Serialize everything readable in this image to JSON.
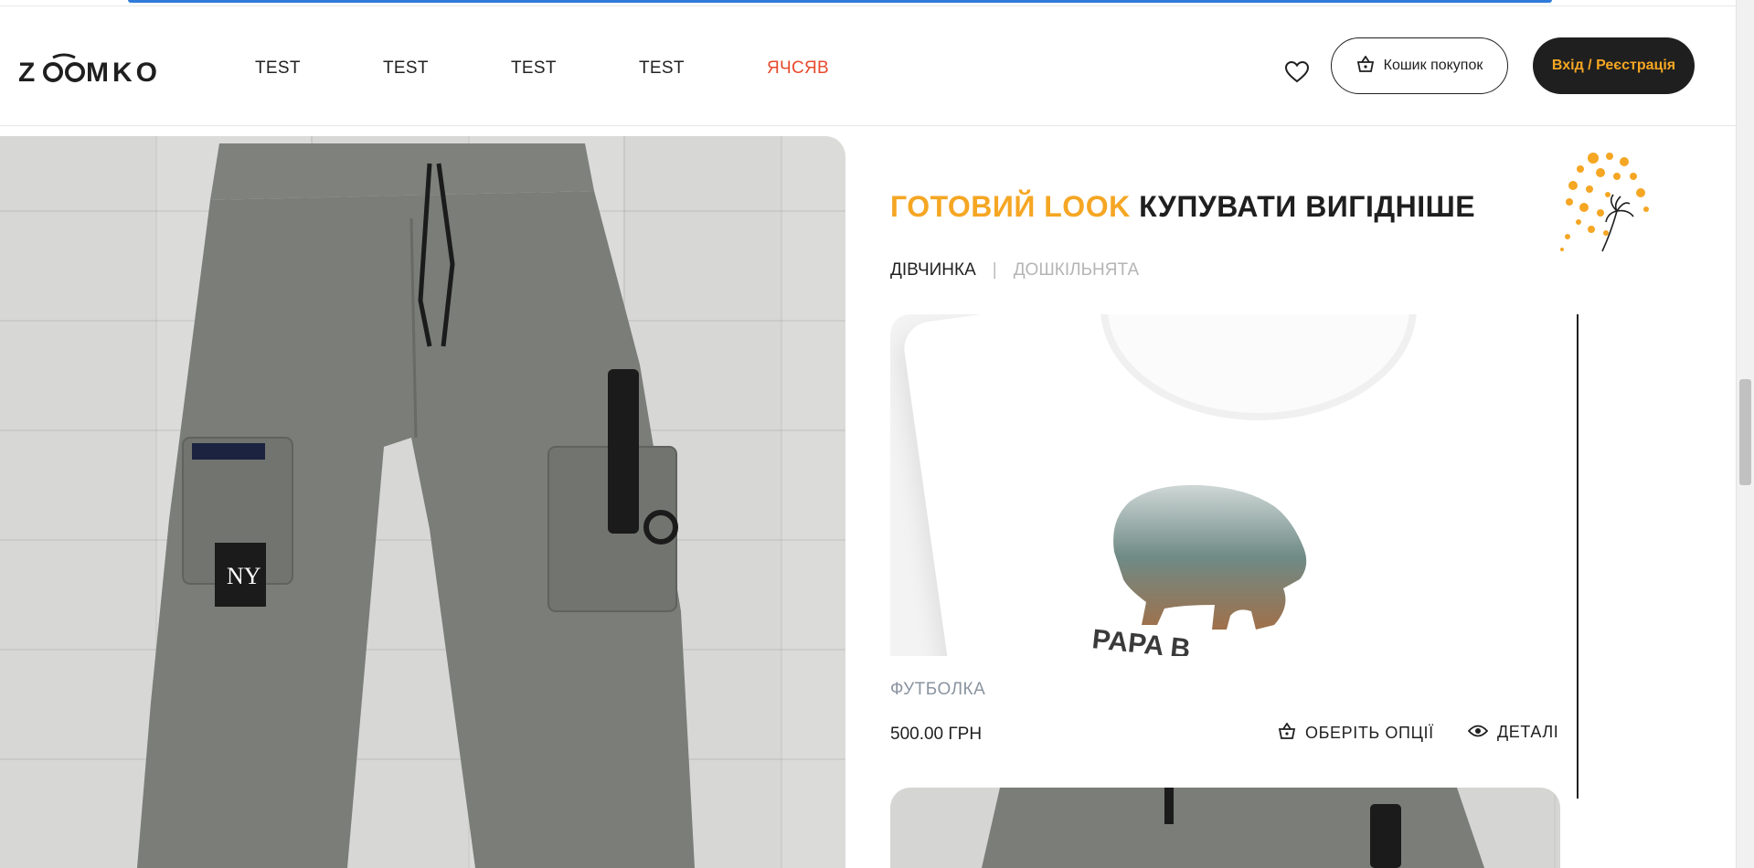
{
  "header": {
    "logo_text": "ZOOMKO",
    "nav": [
      "TEST",
      "TEST",
      "TEST",
      "TEST",
      "ЯЧСЯВ"
    ],
    "cart_label": "Кошик покупок",
    "login_label": "Вхід / Реєстрація"
  },
  "look": {
    "title_accent": "ГОТОВИЙ LOOK",
    "title_rest": " КУПУВАТИ ВИГІДНІШЕ",
    "crumbs": [
      "ДІВЧИНКА",
      "|",
      "ДОШКІЛЬНЯТА"
    ]
  },
  "product": {
    "name": "ФУТБОЛКА",
    "price": "500.00 ГРН",
    "options_label": "ОБЕРІТЬ ОПЦІЇ",
    "details_label": "ДЕТАЛІ",
    "print_text": "PAPA B"
  },
  "colors": {
    "accent_orange": "#f5a623",
    "accent_red": "#e8492c",
    "dark": "#1f1f1f",
    "browser_blue": "#2f7bd9"
  }
}
